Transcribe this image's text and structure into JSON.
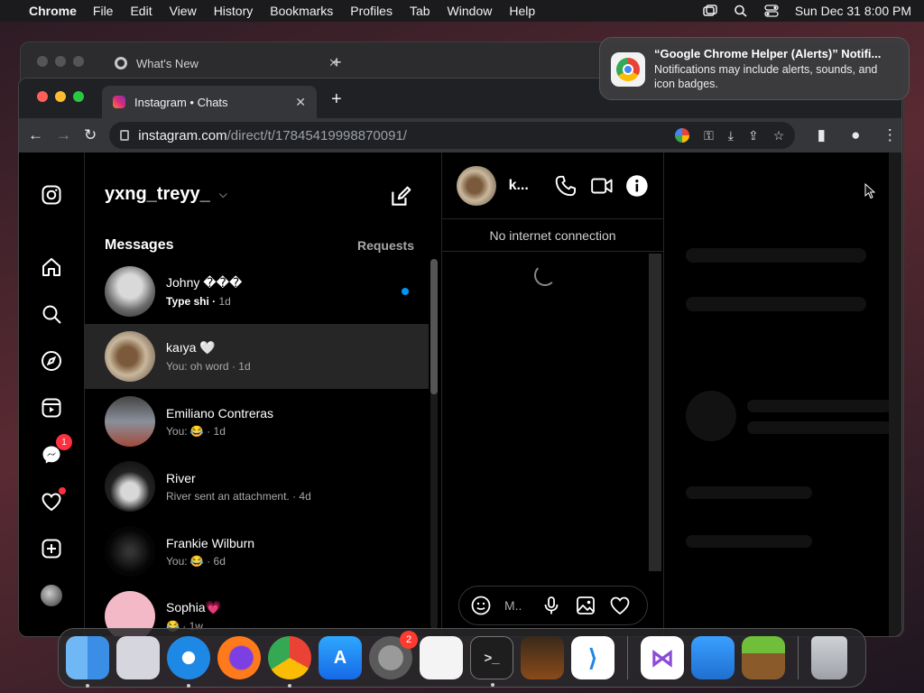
{
  "menubar": {
    "app": "Chrome",
    "items": [
      "File",
      "Edit",
      "View",
      "History",
      "Bookmarks",
      "Profiles",
      "Tab",
      "Window",
      "Help"
    ],
    "clock": "Sun Dec 31  8:00 PM"
  },
  "background_window": {
    "tab_title": "What's New"
  },
  "browser": {
    "tab_title": "Instagram • Chats",
    "url_host": "instagram.com",
    "url_path": "/direct/t/17845419998870091/"
  },
  "instagram": {
    "username": "yxng_treyy_",
    "messages_title": "Messages",
    "requests_label": "Requests",
    "messenger_badge": "1",
    "chats": [
      {
        "name": "Johny ���",
        "preview": "Type shi",
        "time": "1d",
        "unread": true
      },
      {
        "name": "kaıya 🤍",
        "preview": "You: oh word",
        "time": "1d"
      },
      {
        "name": "Emiliano Contreras",
        "preview": "You: 😂",
        "time": "1d"
      },
      {
        "name": "River",
        "preview": "River sent an attachment.",
        "time": "4d"
      },
      {
        "name": "Frankie Wilburn",
        "preview": "You: 😂",
        "time": "6d"
      },
      {
        "name": "Sophia💗",
        "preview": "😂",
        "time": "1w"
      }
    ],
    "conversation": {
      "name": "k...",
      "banner": "No internet connection",
      "composer_placeholder": "M.."
    }
  },
  "notification": {
    "title": "“Google Chrome Helper (Alerts)” Notifi...",
    "body": "Notifications may include alerts, sounds, and icon badges."
  },
  "dock": {
    "settings_badge": "2"
  }
}
